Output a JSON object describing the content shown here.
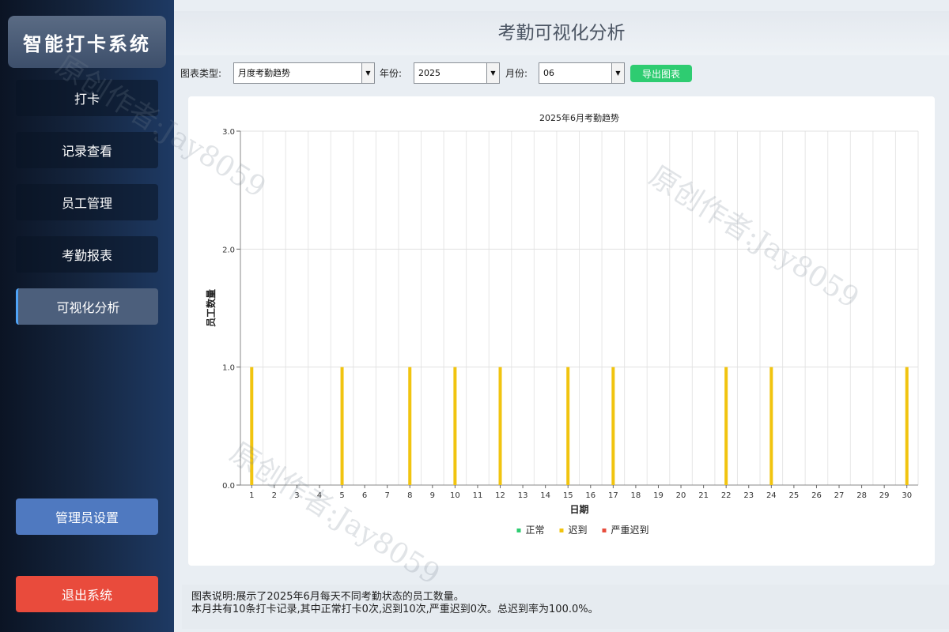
{
  "sidebar": {
    "brand": "智能打卡系统",
    "items": [
      {
        "label": "打卡"
      },
      {
        "label": "记录查看"
      },
      {
        "label": "员工管理"
      },
      {
        "label": "考勤报表"
      },
      {
        "label": "可视化分析"
      }
    ],
    "admin_label": "管理员设置",
    "exit_label": "退出系统"
  },
  "header": {
    "title": "考勤可视化分析"
  },
  "toolbar": {
    "chart_type_label": "图表类型:",
    "chart_type_value": "月度考勤趋势",
    "year_label": "年份:",
    "year_value": "2025",
    "month_label": "月份:",
    "month_value": "06",
    "export_label": "导出图表"
  },
  "chart_data": {
    "type": "bar",
    "title": "2025年6月考勤趋势",
    "xlabel": "日期",
    "ylabel": "员工数量",
    "ylim": [
      0,
      3
    ],
    "yticks": [
      "0.0",
      "1.0",
      "2.0",
      "3.0"
    ],
    "categories": [
      "1",
      "2",
      "3",
      "4",
      "5",
      "6",
      "7",
      "8",
      "9",
      "10",
      "11",
      "12",
      "13",
      "14",
      "15",
      "16",
      "17",
      "18",
      "19",
      "20",
      "21",
      "22",
      "23",
      "24",
      "25",
      "26",
      "27",
      "28",
      "29",
      "30"
    ],
    "series": [
      {
        "name": "正常",
        "color": "#2ecc71",
        "values": [
          0,
          0,
          0,
          0,
          0,
          0,
          0,
          0,
          0,
          0,
          0,
          0,
          0,
          0,
          0,
          0,
          0,
          0,
          0,
          0,
          0,
          0,
          0,
          0,
          0,
          0,
          0,
          0,
          0,
          0
        ]
      },
      {
        "name": "迟到",
        "color": "#f1c40f",
        "values": [
          1,
          0,
          0,
          0,
          1,
          0,
          0,
          1,
          0,
          1,
          0,
          1,
          0,
          0,
          1,
          0,
          1,
          0,
          0,
          0,
          0,
          1,
          0,
          1,
          0,
          0,
          0,
          0,
          0,
          1
        ]
      },
      {
        "name": "严重迟到",
        "color": "#e74c3c",
        "values": [
          0,
          0,
          0,
          0,
          0,
          0,
          0,
          0,
          0,
          0,
          0,
          0,
          0,
          0,
          0,
          0,
          0,
          0,
          0,
          0,
          0,
          0,
          0,
          0,
          0,
          0,
          0,
          0,
          0,
          0
        ]
      }
    ],
    "grid": true,
    "legend": "bottom-center"
  },
  "description": {
    "line1": "图表说明:展示了2025年6月每天不同考勤状态的员工数量。",
    "line2": "本月共有10条打卡记录,其中正常打卡0次,迟到10次,严重迟到0次。总迟到率为100.0%。"
  },
  "watermark": {
    "text": "原创作者:Jay8059"
  }
}
